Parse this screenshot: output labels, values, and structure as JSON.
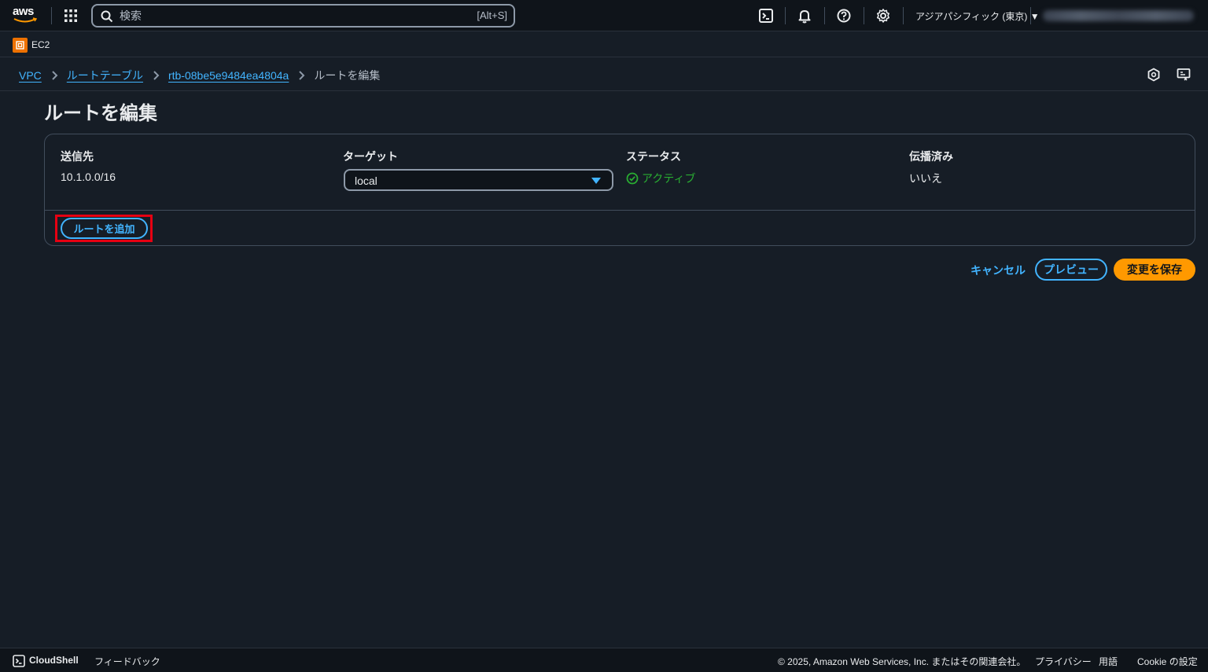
{
  "topnav": {
    "logo_text": "aws",
    "search_placeholder": "検索",
    "search_shortcut": "[Alt+S]",
    "region": "アジアパシフィック (東京) ▼"
  },
  "service": {
    "name": "EC2"
  },
  "breadcrumb": {
    "items": [
      "VPC",
      "ルートテーブル",
      "rtb-08be5e9484ea4804a"
    ],
    "current": "ルートを編集"
  },
  "page": {
    "title": "ルートを編集"
  },
  "routes": {
    "columns": {
      "destination": "送信先",
      "target": "ターゲット",
      "status": "ステータス",
      "propagated": "伝播済み"
    },
    "rows": [
      {
        "destination": "10.1.0.0/16",
        "target": "local",
        "status": "アクティブ",
        "propagated": "いいえ"
      }
    ],
    "add_route_label": "ルートを追加"
  },
  "actions": {
    "cancel": "キャンセル",
    "preview": "プレビュー",
    "save": "変更を保存"
  },
  "footer": {
    "cloudshell": "CloudShell",
    "feedback": "フィードバック",
    "copyright": "© 2025, Amazon Web Services, Inc. またはその関連会社。",
    "privacy": "プライバシー",
    "terms": "用語",
    "cookie": "Cookie の設定"
  },
  "colors": {
    "background": "#161d26",
    "link": "#42b4ff",
    "primary_button": "#ff9900",
    "success": "#29ad32",
    "highlight": "#e60012"
  }
}
